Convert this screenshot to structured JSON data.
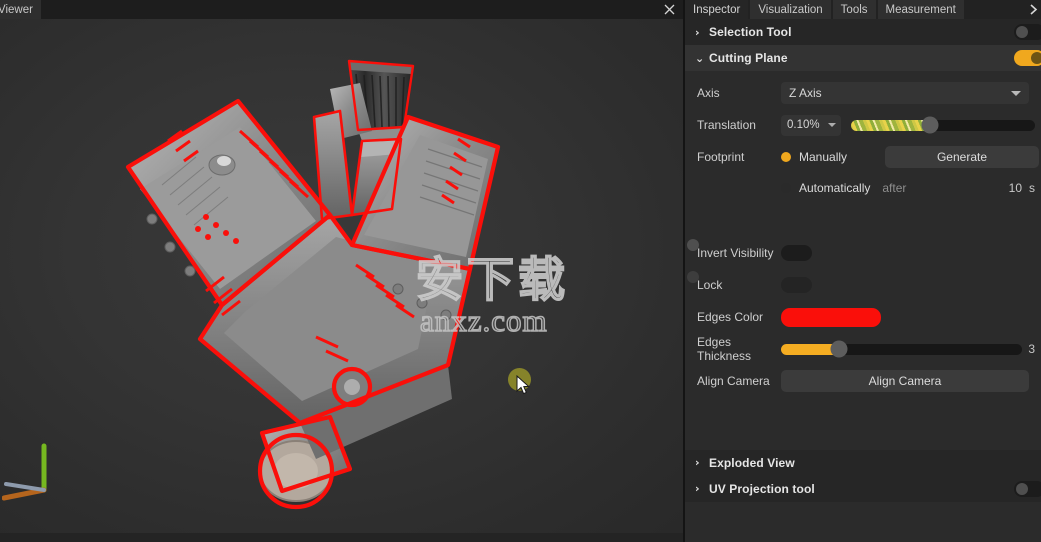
{
  "viewer": {
    "tab_label": "Viewer",
    "close_icon": "close-icon",
    "watermark_cn": "安下载",
    "watermark_en": "anxz.com"
  },
  "inspector": {
    "tabs": [
      {
        "label": "Inspector",
        "active": true
      },
      {
        "label": "Visualization",
        "active": false
      },
      {
        "label": "Tools",
        "active": false
      },
      {
        "label": "Measurement",
        "active": false
      }
    ],
    "overflow_icon": "chevron-right-icon",
    "sections": [
      {
        "title": "Selection Tool",
        "expanded": false,
        "arrow": "›",
        "toggle": "off"
      },
      {
        "title": "Cutting Plane",
        "expanded": true,
        "arrow": "⌄",
        "toggle": "on"
      },
      {
        "title": "Exploded View",
        "expanded": false,
        "arrow": "›",
        "toggle": null
      },
      {
        "title": "UV Projection tool",
        "expanded": false,
        "arrow": "›",
        "toggle": "off"
      }
    ],
    "cutting_plane": {
      "axis": {
        "label": "Axis",
        "value": "Z Axis"
      },
      "translation": {
        "label": "Translation",
        "value": "0.10%",
        "slider_percent": 43
      },
      "footprint": {
        "label": "Footprint",
        "manually_label": "Manually",
        "manually_selected": true,
        "generate_label": "Generate",
        "automatically_label": "Automatically",
        "automatically_selected": false,
        "after_label": "after",
        "after_value": "10",
        "after_unit": "s"
      },
      "invert_visibility": {
        "label": "Invert Visibility",
        "state": "off"
      },
      "lock": {
        "label": "Lock",
        "state": "off"
      },
      "edges_color": {
        "label": "Edges Color",
        "color": "#fa0f0a"
      },
      "edges_thickness": {
        "label": "Edges Thickness",
        "value": "3",
        "slider_percent": 24,
        "fill_color": "#f5ad22"
      },
      "align_camera": {
        "label": "Align Camera",
        "button_label": "Align Camera"
      }
    }
  },
  "theme": {
    "accent": "#f0a81e",
    "edge_red": "#fa0f0a",
    "panel_bg": "#2b2b2b",
    "viewport_bg": "#323232"
  }
}
